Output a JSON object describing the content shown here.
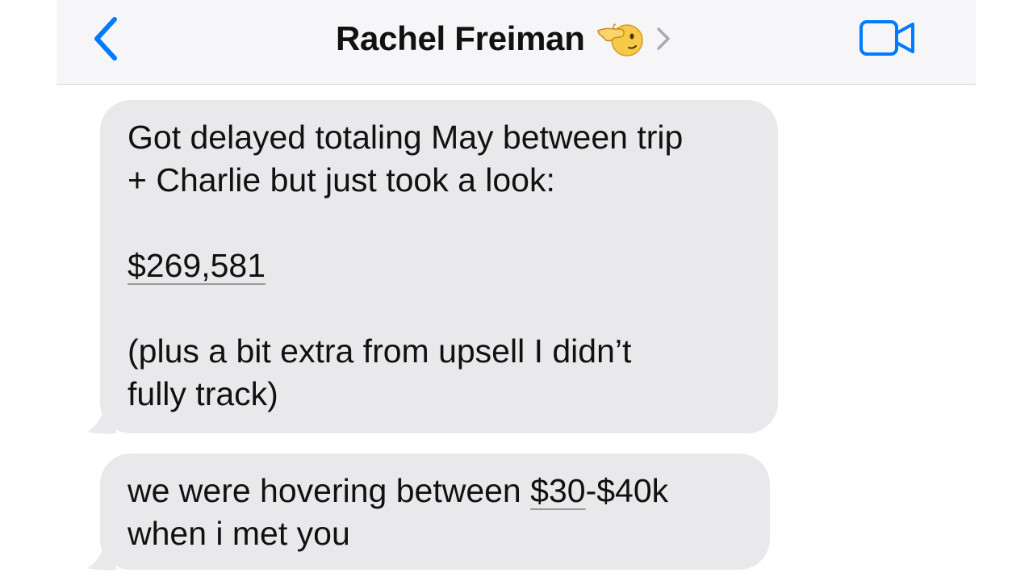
{
  "header": {
    "contact_name": "Rachel Freiman",
    "emoji_icon": "pointing-hand-face-emoji",
    "back_icon": "chevron-left-icon",
    "details_icon": "chevron-right-icon",
    "video_icon": "video-camera-icon"
  },
  "messages": [
    {
      "lines": [
        "Got delayed totaling May between trip",
        "+ Charlie but just took a look:"
      ],
      "amount": "$269,581",
      "lines_after": [
        "(plus a bit extra from upsell I didn’t",
        "fully track)"
      ]
    },
    {
      "line1_before": "we were hovering between ",
      "line1_link": "$30",
      "line1_after": "-$40k",
      "line2": "when i met you"
    }
  ],
  "colors": {
    "accent": "#007aff",
    "bubble": "#e9e9eb",
    "header_bg": "#f6f6f8",
    "text": "#111111"
  }
}
